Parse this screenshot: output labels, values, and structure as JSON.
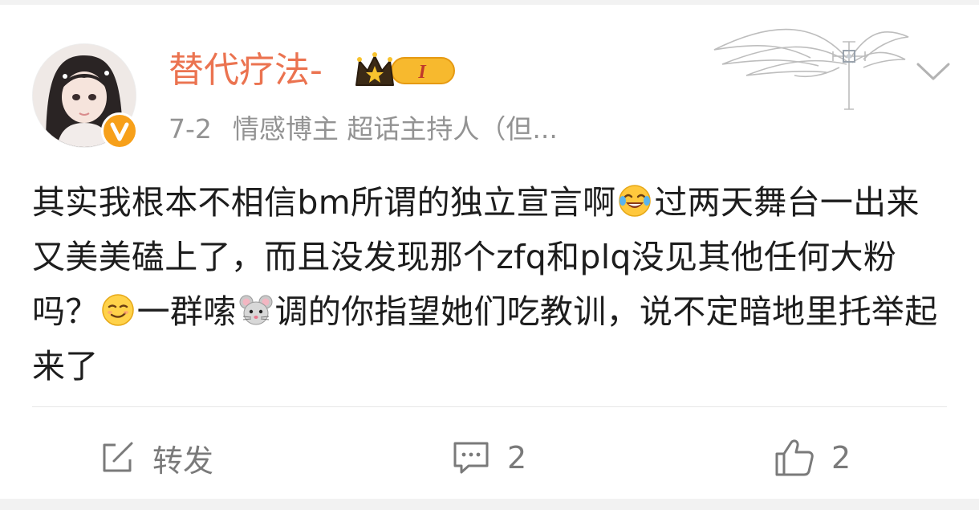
{
  "post": {
    "author": {
      "name": "替代疗法-",
      "vip_level": "I",
      "verified_color": "#f7a01a",
      "avatar_icon": "avatar-photo"
    },
    "meta": {
      "date": "7-2",
      "tags": "情感博主 超话主持人（但..."
    },
    "text_parts": {
      "p1": "其实我根本不相信bm所谓的独立宣言啊",
      "p2": "过两天舞台一出来又美美磕上了，而且没发现那个zfq和plq没见其他任何大粉吗？",
      "p3": "一群嗦",
      "p4": "调的你指望她们吃教训，说不定暗地里托举起来了"
    },
    "emojis": [
      "laughing-tears-emoji",
      "smirk-emoji",
      "mouse-emoji"
    ],
    "actions": {
      "repost_label": "转发",
      "comment_count": "2",
      "like_count": "2"
    }
  },
  "colors": {
    "username": "#eb7350",
    "meta": "#939393",
    "text": "#1d1d1d",
    "action": "#7a7a7a"
  }
}
